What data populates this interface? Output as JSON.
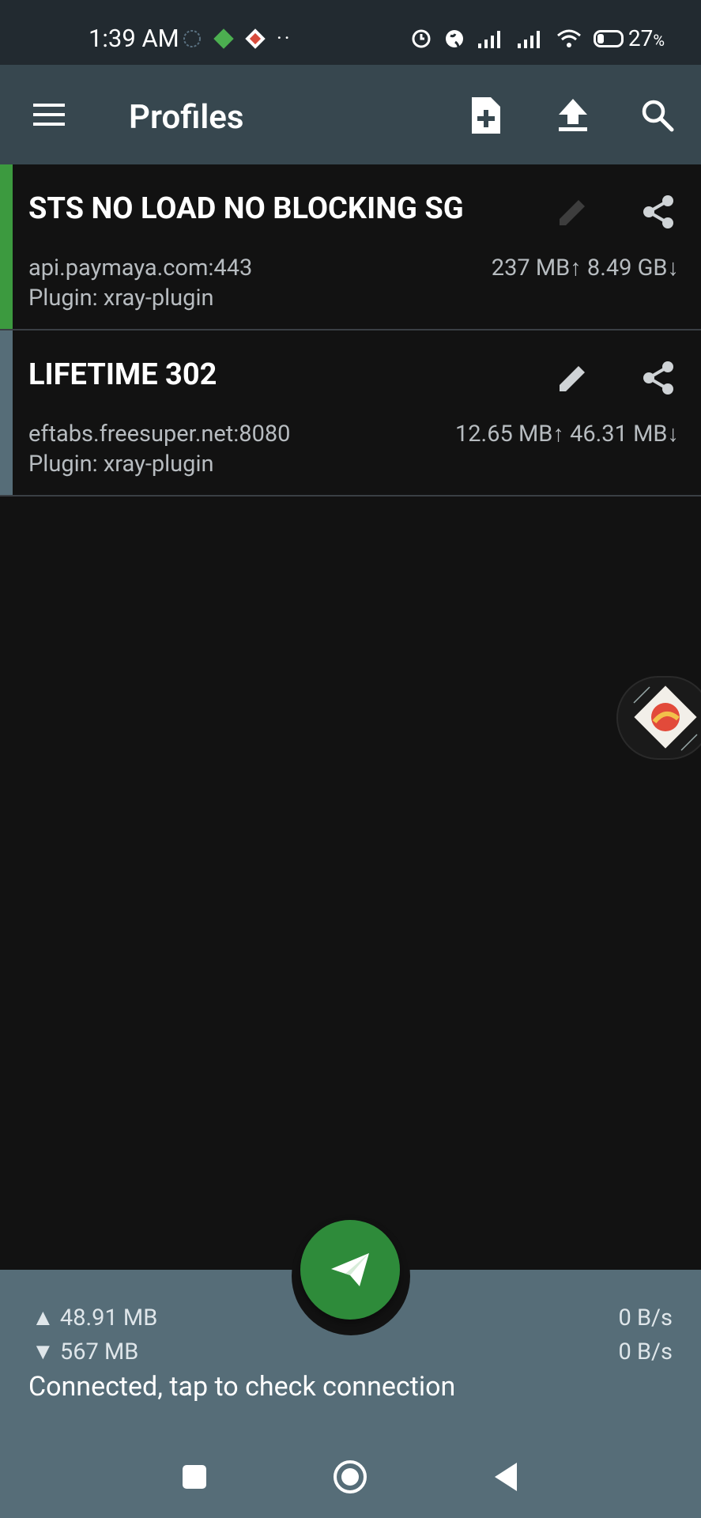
{
  "status_bar": {
    "time": "1:39 AM",
    "battery": "27",
    "battery_unit": "%"
  },
  "app_bar": {
    "title": "Profiles",
    "icons": [
      "menu-icon",
      "add-file-icon",
      "upload-icon",
      "search-icon"
    ]
  },
  "profiles": [
    {
      "name": "STS NO LOAD NO BLOCKING SG",
      "host": "api.paymaya.com:443",
      "plugin": "Plugin: xray-plugin",
      "traffic": "237 MB↑ 8.49 GB↓",
      "stripe_color": "#3c9a3f",
      "selected": true
    },
    {
      "name": "LIFETIME 302",
      "host": "eftabs.freesuper.net:8080",
      "plugin": "Plugin: xray-plugin",
      "traffic": "12.65 MB↑  46.31 MB↓",
      "stripe_color": "#566d78",
      "selected": false
    }
  ],
  "stats": {
    "upload_total": "▲ 48.91 MB",
    "download_total": "▼ 567 MB",
    "upload_rate": "0 B/s",
    "download_rate": "0 B/s",
    "connection_status": "Connected, tap to check connection"
  },
  "colors": {
    "accent_green": "#2e8b3a",
    "app_bar": "#37474f",
    "bottom_panel": "#566d78"
  }
}
